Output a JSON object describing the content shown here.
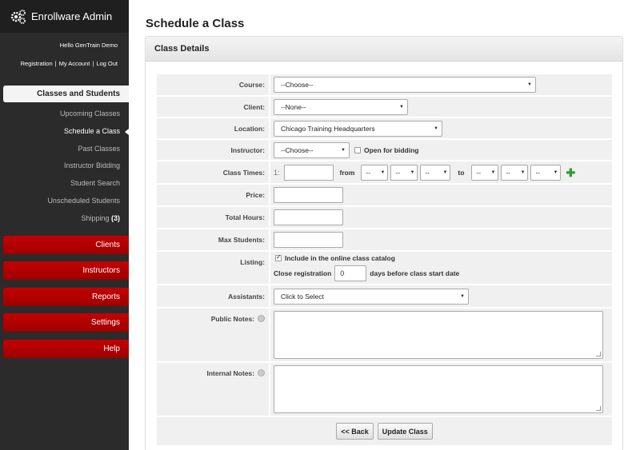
{
  "app": {
    "title": "Enrollware Admin"
  },
  "user": {
    "hello": "Hello GenTrain Demo",
    "links": [
      "Registration",
      "My Account",
      "Log Out"
    ]
  },
  "nav": {
    "section_title": "Classes and Students",
    "sub_items": [
      {
        "label": "Upcoming Classes"
      },
      {
        "label": "Schedule a Class"
      },
      {
        "label": "Past Classes"
      },
      {
        "label": "Instructor Bidding"
      },
      {
        "label": "Student Search"
      },
      {
        "label": "Unscheduled Students"
      },
      {
        "label": "Shipping",
        "badge": "(3)"
      }
    ],
    "main_items": [
      "Clients",
      "Instructors",
      "Reports",
      "Settings",
      "Help"
    ]
  },
  "page": {
    "title": "Schedule a Class",
    "panel_title": "Class Details"
  },
  "form": {
    "course": {
      "label": "Course:",
      "value": "--Choose--"
    },
    "client": {
      "label": "Client:",
      "value": "--None--"
    },
    "location": {
      "label": "Location:",
      "value": "Chicago Training Headquarters"
    },
    "instructor": {
      "label": "Instructor:",
      "value": "--Choose--",
      "bidding_label": "Open for bidding"
    },
    "class_times": {
      "label": "Class Times:",
      "index": "1:",
      "from": "from",
      "to": "to",
      "placeholder": "--"
    },
    "price": {
      "label": "Price:"
    },
    "total_hours": {
      "label": "Total Hours:"
    },
    "max_students": {
      "label": "Max Students:"
    },
    "listing": {
      "label": "Listing:",
      "include_label": "Include in the online class catalog",
      "close_prefix": "Close registration",
      "close_value": "0",
      "close_suffix": "days before class start date"
    },
    "assistants": {
      "label": "Assistants:",
      "value": "Click to Select"
    },
    "public_notes": {
      "label": "Public Notes:"
    },
    "internal_notes": {
      "label": "Internal Notes:"
    }
  },
  "buttons": {
    "back": "<< Back",
    "update": "Update Class"
  }
}
